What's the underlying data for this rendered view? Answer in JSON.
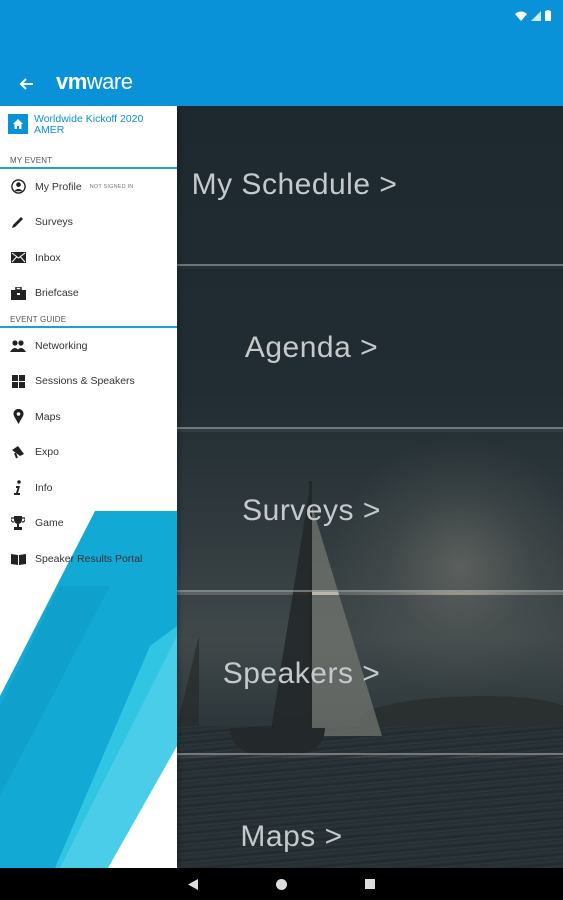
{
  "app": {
    "brand_prefix": "vm",
    "brand_suffix": "ware"
  },
  "drawer": {
    "event_title": "Worldwide Kickoff 2020 AMER",
    "my_event_label": "MY EVENT",
    "event_guide_label": "EVENT GUIDE",
    "my_event_items": [
      {
        "label": "My Profile",
        "note": "NOT SIGNED IN",
        "icon": "profile-icon"
      },
      {
        "label": "Surveys",
        "icon": "pencil-icon"
      },
      {
        "label": "Inbox",
        "icon": "mail-icon"
      },
      {
        "label": "Briefcase",
        "icon": "briefcase-icon"
      }
    ],
    "event_guide_items": [
      {
        "label": "Networking",
        "icon": "people-icon"
      },
      {
        "label": "Sessions & Speakers",
        "icon": "grid-icon"
      },
      {
        "label": "Maps",
        "icon": "map-pin-icon"
      },
      {
        "label": "Expo",
        "icon": "megaphone-icon"
      },
      {
        "label": "Info",
        "icon": "info-icon"
      },
      {
        "label": "Game",
        "icon": "trophy-icon"
      },
      {
        "label": "Speaker Results Portal",
        "icon": "book-icon"
      }
    ]
  },
  "tiles": [
    {
      "label": "My Schedule >"
    },
    {
      "label": "Agenda >"
    },
    {
      "label": "Surveys >"
    },
    {
      "label": "Speakers >"
    },
    {
      "label": "Maps >"
    }
  ],
  "colors": {
    "app_bar": "#0a92d9",
    "accent": "#1a9fd8"
  }
}
